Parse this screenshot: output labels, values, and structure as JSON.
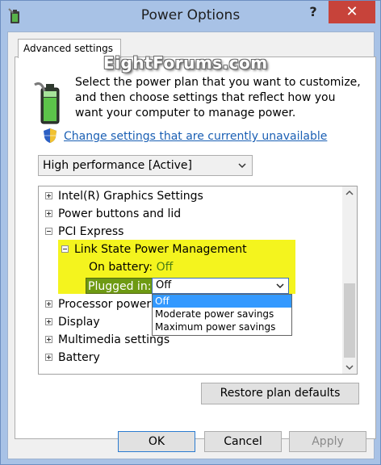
{
  "window": {
    "title": "Power Options",
    "help": "?",
    "close": "✕"
  },
  "tab": {
    "label": "Advanced settings"
  },
  "watermark": "EightForums.com",
  "intro": {
    "text": "Select the power plan that you want to customize, and then choose settings that reflect how you want your computer to manage power."
  },
  "change_link": "Change settings that are currently unavailable",
  "plan_select": {
    "value": "High performance [Active]"
  },
  "tree": {
    "items": [
      {
        "label": "Intel(R) Graphics Settings"
      },
      {
        "label": "Power buttons and lid"
      },
      {
        "label": "PCI Express"
      },
      {
        "label": "Link State Power Management"
      },
      {
        "label": "On battery:",
        "value": "Off"
      },
      {
        "label": "Plugged in:",
        "value": "Off"
      },
      {
        "label": "Processor power m"
      },
      {
        "label": "Display"
      },
      {
        "label": "Multimedia settings"
      },
      {
        "label": "Battery"
      }
    ],
    "dropdown_options": [
      "Off",
      "Moderate power savings",
      "Maximum power savings"
    ]
  },
  "buttons": {
    "restore": "Restore plan defaults",
    "ok": "OK",
    "cancel": "Cancel",
    "apply": "Apply"
  },
  "colors": {
    "highlight": "#f4f41e",
    "selected": "#3399ff",
    "link": "#1a5fb4",
    "close": "#c7433a"
  },
  "icons": [
    "power-options-app-icon",
    "battery-plan-icon",
    "uac-shield-icon",
    "chevron-down-icon",
    "scroll-up-icon",
    "scroll-down-icon"
  ]
}
